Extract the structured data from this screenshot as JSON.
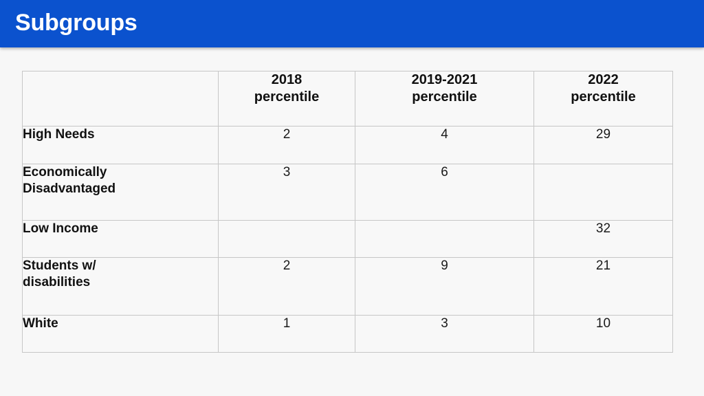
{
  "slide": {
    "title": "Subgroups",
    "title_bar_color": "#0b52ce",
    "title_text_color": "#ffffff",
    "background_color": "#f7f7f7"
  },
  "table": {
    "border_color": "#c6c6c6",
    "cell_background": "#f8f8f8",
    "headers": [
      {
        "line1": "",
        "line2": ""
      },
      {
        "line1": "2018",
        "line2": "percentile"
      },
      {
        "line1": "2019-2021",
        "line2": "percentile"
      },
      {
        "line1": "2022",
        "line2": "percentile"
      }
    ],
    "rows": [
      {
        "label_line1": "High Needs",
        "label_line2": "",
        "v2018": "2",
        "v2019_2021": "4",
        "v2022": "29"
      },
      {
        "label_line1": "Economically",
        "label_line2": "Disadvantaged",
        "v2018": "3",
        "v2019_2021": "6",
        "v2022": ""
      },
      {
        "label_line1": "Low Income",
        "label_line2": "",
        "v2018": "",
        "v2019_2021": "",
        "v2022": "32"
      },
      {
        "label_line1": "Students w/",
        "label_line2": "disabilities",
        "v2018": "2",
        "v2019_2021": "9",
        "v2022": "21"
      },
      {
        "label_line1": "White",
        "label_line2": "",
        "v2018": "1",
        "v2019_2021": "3",
        "v2022": "10"
      }
    ]
  }
}
